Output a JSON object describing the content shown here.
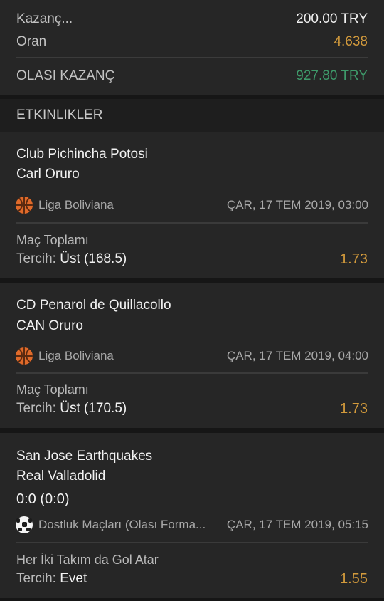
{
  "summary": {
    "stake_label": "Kazanç...",
    "stake_value": "200.00 TRY",
    "odds_label": "Oran",
    "odds_value": "4.638",
    "potential_label": "OLASI KAZANÇ",
    "potential_value": "927.80 TRY"
  },
  "section_title": "ETKINLIKLER",
  "events": [
    {
      "home": "Club Pichincha Potosi",
      "away": "Carl Oruro",
      "sport_icon": "basketball-icon",
      "league": "Liga Boliviana",
      "datetime": "ÇAR, 17 TEM 2019, 03:00",
      "market": "Maç Toplamı",
      "pick_label": "Tercih:",
      "pick": "Üst (168.5)",
      "odd": "1.73"
    },
    {
      "home": "CD Penarol de Quillacollo",
      "away": "CAN Oruro",
      "sport_icon": "basketball-icon",
      "league": "Liga Boliviana",
      "datetime": "ÇAR, 17 TEM 2019, 04:00",
      "market": "Maç Toplamı",
      "pick_label": "Tercih:",
      "pick": "Üst (170.5)",
      "odd": "1.73"
    },
    {
      "home": "San Jose Earthquakes",
      "away": "Real Valladolid",
      "score": "0:0 (0:0)",
      "sport_icon": "soccer-ball-icon",
      "league": "Dostluk Maçları (Olası Forma...",
      "datetime": "ÇAR, 17 TEM 2019, 05:15",
      "market": "Her İki Takım da Gol Atar",
      "pick_label": "Tercih:",
      "pick": "Evet",
      "odd": "1.55"
    }
  ],
  "colors": {
    "accent_odds": "#d29a3c",
    "potential_win": "#3e9a6a",
    "panel": "#262626",
    "background": "#161616"
  }
}
